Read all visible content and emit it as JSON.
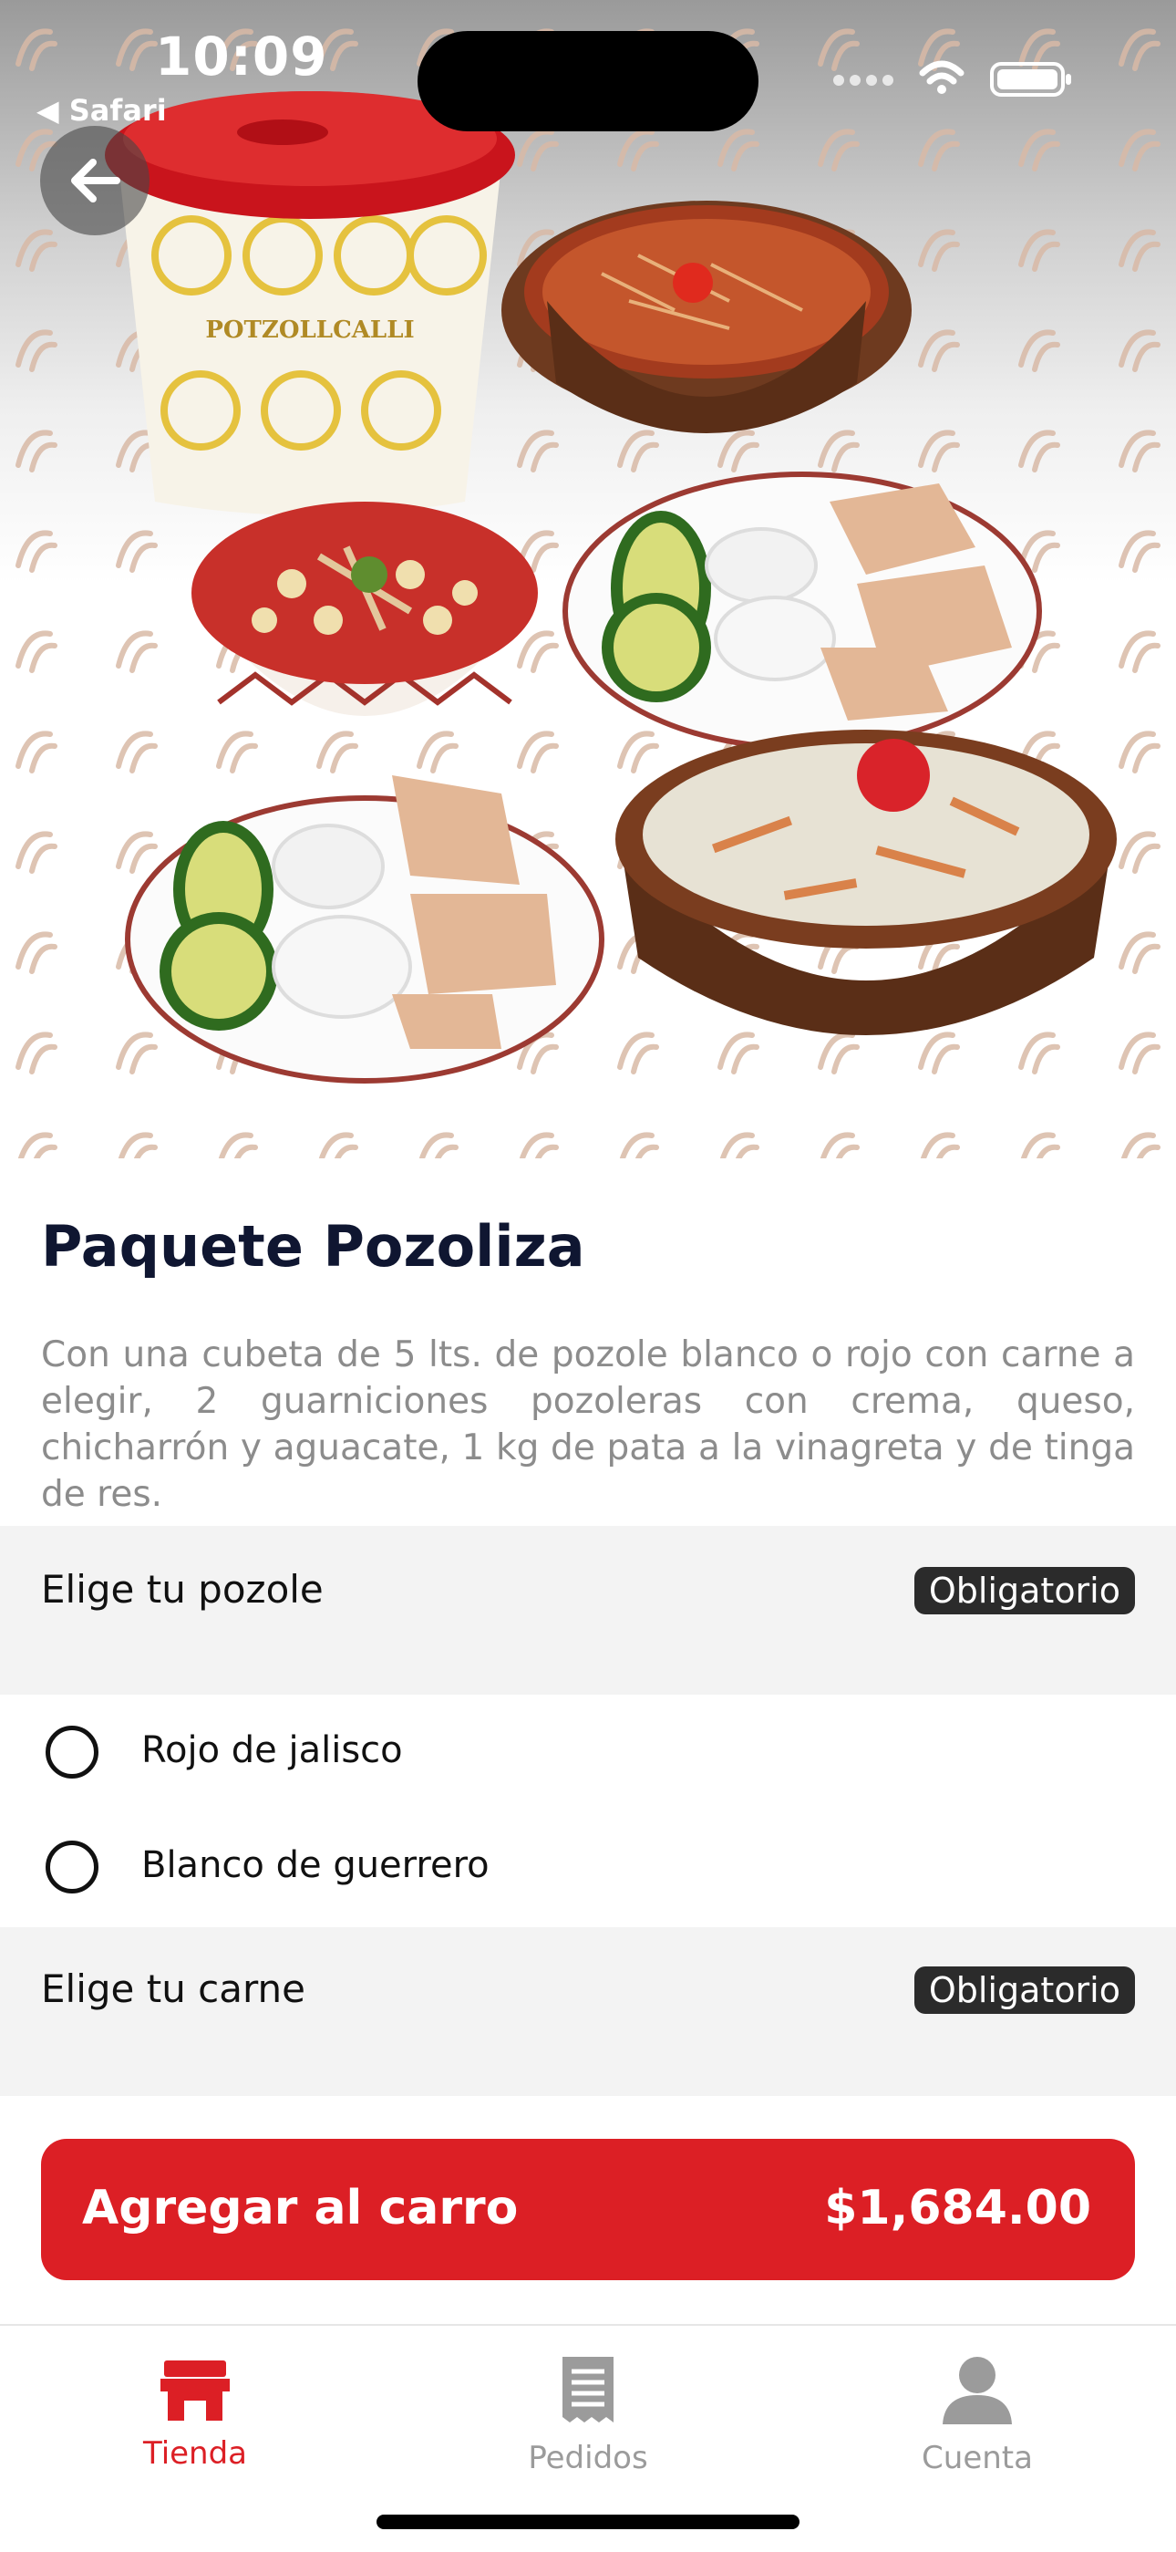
{
  "status_bar": {
    "time": "10:09",
    "back_app": "◀ Safari"
  },
  "product": {
    "title": "Paquete Pozoliza",
    "description": "Con una cubeta de 5 lts. de pozole blanco o rojo con carne a elegir, 2 guarniciones pozoleras con crema, queso, chicharrón y aguacate, 1 kg de pata a la vinagreta y de tinga de res.",
    "image_brand_text": "POTZOLLCALLI"
  },
  "groups": [
    {
      "label": "Elige tu pozole",
      "badge": "Obligatorio",
      "options": [
        "Rojo de jalisco",
        "Blanco de guerrero"
      ]
    },
    {
      "label": "Elige tu carne",
      "badge": "Obligatorio",
      "options": []
    }
  ],
  "cta": {
    "label": "Agregar al carro",
    "price": "$1,684.00"
  },
  "tabs": [
    {
      "label": "Tienda",
      "icon": "store-icon",
      "active": true
    },
    {
      "label": "Pedidos",
      "icon": "receipt-icon",
      "active": false
    },
    {
      "label": "Cuenta",
      "icon": "person-icon",
      "active": false
    }
  ],
  "colors": {
    "accent": "#dc1f25",
    "title": "#0f1631",
    "description": "#8c8c8c",
    "badge_bg": "#2b2b2b",
    "group_bg": "#f3f3f3",
    "tab_inactive": "#9b9b9b"
  }
}
